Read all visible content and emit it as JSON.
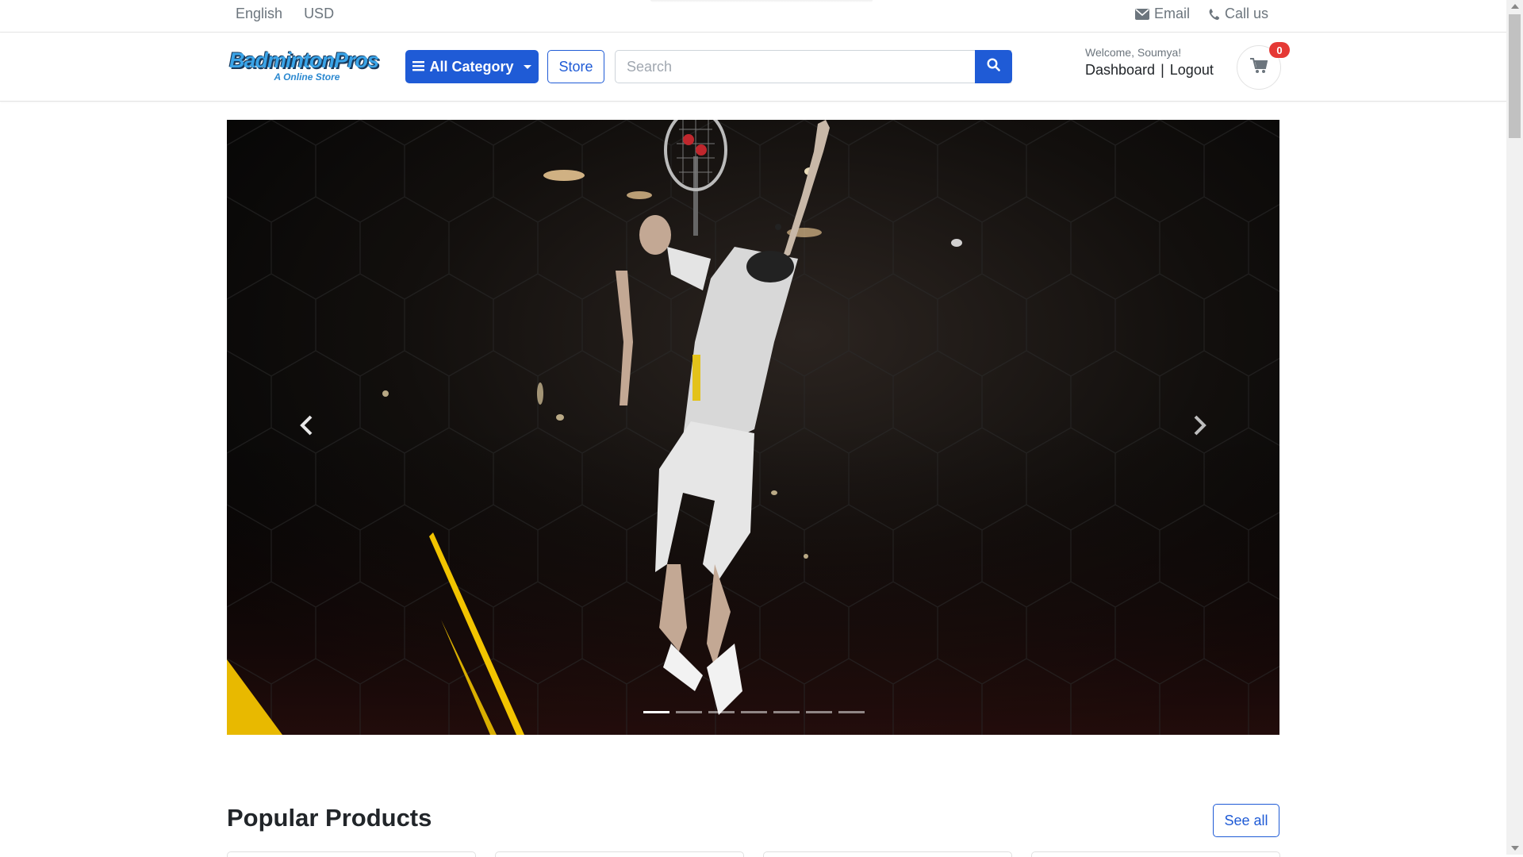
{
  "topbar": {
    "language": "English",
    "currency": "USD",
    "email_label": "Email",
    "call_label": "Call us"
  },
  "header": {
    "logo_text": "BadmintonPros",
    "logo_tagline": "A Online Store",
    "category_button": "All Category",
    "store_button": "Store",
    "search_placeholder": "Search",
    "welcome": "Welcome, Soumya!",
    "dashboard_link": "Dashboard",
    "separator": "|",
    "logout_link": "Logout",
    "cart_count": "0"
  },
  "carousel": {
    "slide_count": 7,
    "active_index": 0,
    "icons": {
      "prev": "chevron-left-icon",
      "next": "chevron-right-icon"
    }
  },
  "popular": {
    "title": "Popular Products",
    "see_all": "See all"
  },
  "colors": {
    "primary": "#1f5bd6",
    "badge": "#e53935",
    "muted": "#6c757d"
  }
}
